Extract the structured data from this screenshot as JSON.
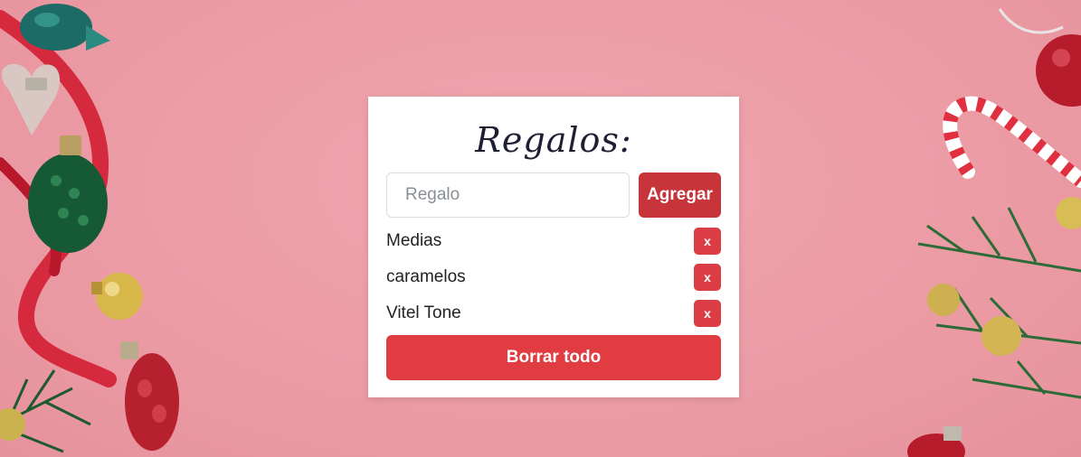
{
  "title": "Regalos:",
  "form": {
    "placeholder": "Regalo",
    "value": "",
    "add_label": "Agregar"
  },
  "gifts": [
    {
      "name": "Medias",
      "remove_label": "x"
    },
    {
      "name": "caramelos",
      "remove_label": "x"
    },
    {
      "name": "Vitel Tone",
      "remove_label": "x"
    }
  ],
  "clear_label": "Borrar todo",
  "colors": {
    "background": "#ec9ca5",
    "add_button": "#c7343a",
    "remove_button": "#dc3d44",
    "clear_button": "#e03c41"
  },
  "decorations": {
    "left": "christmas-ornaments-ribbon",
    "right": "candy-cane-pine-ornaments"
  }
}
